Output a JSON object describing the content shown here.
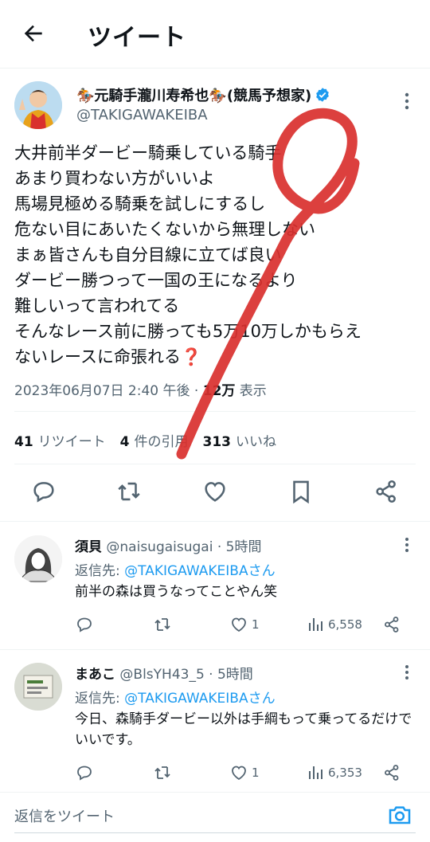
{
  "header": {
    "title": "ツイート"
  },
  "tweet": {
    "display_name": "🏇元騎手瀧川寿希也🏇(競馬予想家)",
    "handle": "@TAKIGAWAKEIBA",
    "lines": [
      "大井前半ダービー騎乗している騎手",
      "あまり買わない方がいいよ",
      "馬場見極める騎乗を試しにするし",
      "危ない目にあいたくないから無理しない",
      "まぁ皆さんも自分目線に立てば良い",
      "ダービー勝つって一国の王になるより",
      "難しいって言われてる",
      "そんなレース前に勝っても5万10万しかもらえ",
      "ないレースに命張れる❓"
    ],
    "timestamp": "2023年06月07日 2:40 午後 · ",
    "views_count": "12万",
    "views_label": " 表示",
    "retweets_count": "41",
    "retweets_label": "リツイート",
    "quotes_count": "4",
    "quotes_label": "件の引用",
    "likes_count": "313",
    "likes_label": "いいね"
  },
  "replies": [
    {
      "name": "須貝",
      "handle": "@naisugaisugai",
      "time": " · 5時間",
      "reply_to_label": "返信先: ",
      "reply_to": "@TAKIGAWAKEIBAさん",
      "text": "前半の森は買うなってことやん笑",
      "likes": "1",
      "views": "6,558"
    },
    {
      "name": "まあこ",
      "handle": "@BlsYH43_5",
      "time": " · 5時間",
      "reply_to_label": "返信先: ",
      "reply_to": "@TAKIGAWAKEIBAさん",
      "text": "今日、森騎手ダービー以外は手綱もって乗ってるだけでいいです。",
      "likes": "1",
      "views": "6,353"
    }
  ],
  "compose": {
    "placeholder": "返信をツイート"
  },
  "colors": {
    "accent": "#1d9bf0",
    "scribble": "#d9302e",
    "muted": "#536471"
  }
}
